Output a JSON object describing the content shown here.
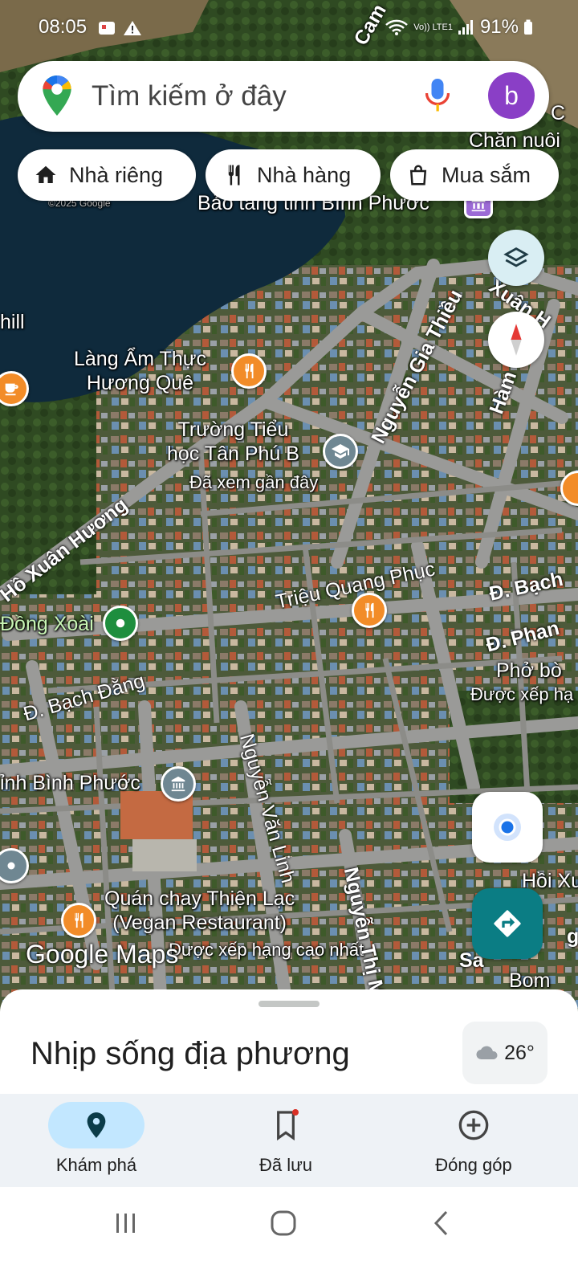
{
  "status_bar": {
    "time": "08:05",
    "network_label": "Vo)) LTE1",
    "battery": "91%"
  },
  "search": {
    "placeholder": "Tìm kiếm ở đây",
    "avatar_letter": "b"
  },
  "chips": [
    {
      "label": "Nhà riêng",
      "icon": "home-icon"
    },
    {
      "label": "Nhà hàng",
      "icon": "restaurant-icon"
    },
    {
      "label": "Mua sắm",
      "icon": "shopping-bag-icon"
    }
  ],
  "map": {
    "labels": {
      "hill": "hill",
      "bao_tang": "Bảo tàng tỉnh Bình Phước",
      "chan_nuoi": "Chăn nuôi",
      "c_partial": "C",
      "cam": "Cam",
      "lang_am_thuc": "Làng Ẩm Thực\nHương Quê",
      "truong_tieu_hoc": "Trường Tiểu\nhọc Tân Phú B",
      "da_xem_gan_day": "Đã xem gần đây",
      "dong_xoai": "Đồng Xoài",
      "tinh_binh_phuoc": "ỉnh Bình Phước",
      "pho_bo": "Phở bò",
      "duoc_xep_hang": "Được xếp hạ",
      "quan_chay": "Quán chay Thiện Lạc\n(Vegan Restaurant)",
      "xep_hang_cao_nhat": "Được xếp hạng cao nhất",
      "hoi_xu": "Hồi Xư",
      "bom": "Bom",
      "sa": "Sa",
      "g": "g",
      "google_maps": "Google Maps",
      "copyright": "©2025 Google"
    },
    "streets": {
      "ho_xuan_huong": "Hồ Xuân Hương",
      "nguyen_gia_thieu": "Nguyễn Gia Thiều",
      "xuan_h": "Xuân H",
      "ham": "Hàm",
      "trieu_quang_phuc": "Triệu Quang Phục",
      "bach_dang_right": "Đ. Bạch",
      "phan_right": "Đ. Phan",
      "bach_dang": "Đ. Bạch Đằng",
      "nguyen_van_linh": "Nguyễn Văn Linh",
      "nguyen_thi_minh": "Nguyễn Thị Min"
    }
  },
  "sheet": {
    "title": "Nhịp sống địa phương",
    "temperature": "26°"
  },
  "bottom_nav": [
    {
      "label": "Khám phá",
      "icon": "explore-pin-icon",
      "active": true
    },
    {
      "label": "Đã lưu",
      "icon": "bookmark-icon",
      "active": false
    },
    {
      "label": "Đóng góp",
      "icon": "add-circle-icon",
      "active": false
    }
  ],
  "colors": {
    "map_pin_orange": "#f28c28",
    "map_pin_gray": "#6f8792",
    "map_pin_green": "#1e8e3e",
    "directions_teal": "#0b7d84",
    "active_nav": "#c2e7ff",
    "avatar_purple": "#8a3fc6"
  }
}
